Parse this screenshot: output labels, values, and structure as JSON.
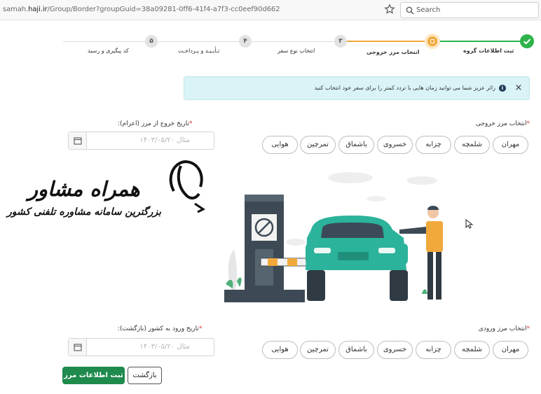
{
  "browser": {
    "url_prefix": "samah.",
    "url_host": "haji.ir",
    "url_path": "/Group/Border?groupGuid=38a09281-0ff6-41f4-a7f3-cc0eef90d662",
    "search_placeholder": "Search"
  },
  "stepper": {
    "steps": [
      {
        "label": "ثبت اطلاعات گروه",
        "number": "",
        "state": "done"
      },
      {
        "label": "انتخاب مرز خروجی",
        "number": "",
        "state": "active"
      },
      {
        "label": "انتخاب نوع سفر",
        "number": "۳",
        "state": "pending"
      },
      {
        "label": "تـأیـیـد و پـرداخـت",
        "number": "۴",
        "state": "pending"
      },
      {
        "label": "کد پیگیری و رسید",
        "number": "۵",
        "state": "pending"
      }
    ],
    "colors": {
      "done": "#2db34a",
      "active": "#f2a93b",
      "pending": "#e3e3e3"
    }
  },
  "alert": {
    "text": "زائر عزیز شما می توانید زمان هایی با تردد کمتر را برای سفر خود انتخاب کنید",
    "info_icon": "i",
    "close_icon": "×"
  },
  "exit_border": {
    "label": "انتخاب مرز خروجی",
    "options": [
      "مهران",
      "شلمچه",
      "چزابه",
      "خسروی",
      "باشماق",
      "تمرچین",
      "هوایی"
    ]
  },
  "exit_date": {
    "label": "تاریخ خروج از مرز (اعزام):",
    "placeholder": "مثال ۱۴۰۳/۰۵/۲۰"
  },
  "entry_border": {
    "label": "انتخاب مرز ورودی",
    "options": [
      "مهران",
      "شلمچه",
      "چزابه",
      "خسروی",
      "باشماق",
      "تمرچین",
      "هوایی"
    ]
  },
  "entry_date": {
    "label": "تاریخ ورود به کشور (بازگشت):",
    "placeholder": "مثال ۱۴۰۳/۰۵/۲۰"
  },
  "actions": {
    "back": "بازگشت",
    "submit": "ثبت اطلاعات مرز"
  },
  "watermark": {
    "title": "همراه مشاور",
    "subtitle": "بزرگترین سامانه مشاوره تلفنی کشور"
  },
  "theme": {
    "accent_green": "#1e8a4c",
    "alert_bg": "#d9f3f6",
    "car_teal": "#2bb39b"
  }
}
